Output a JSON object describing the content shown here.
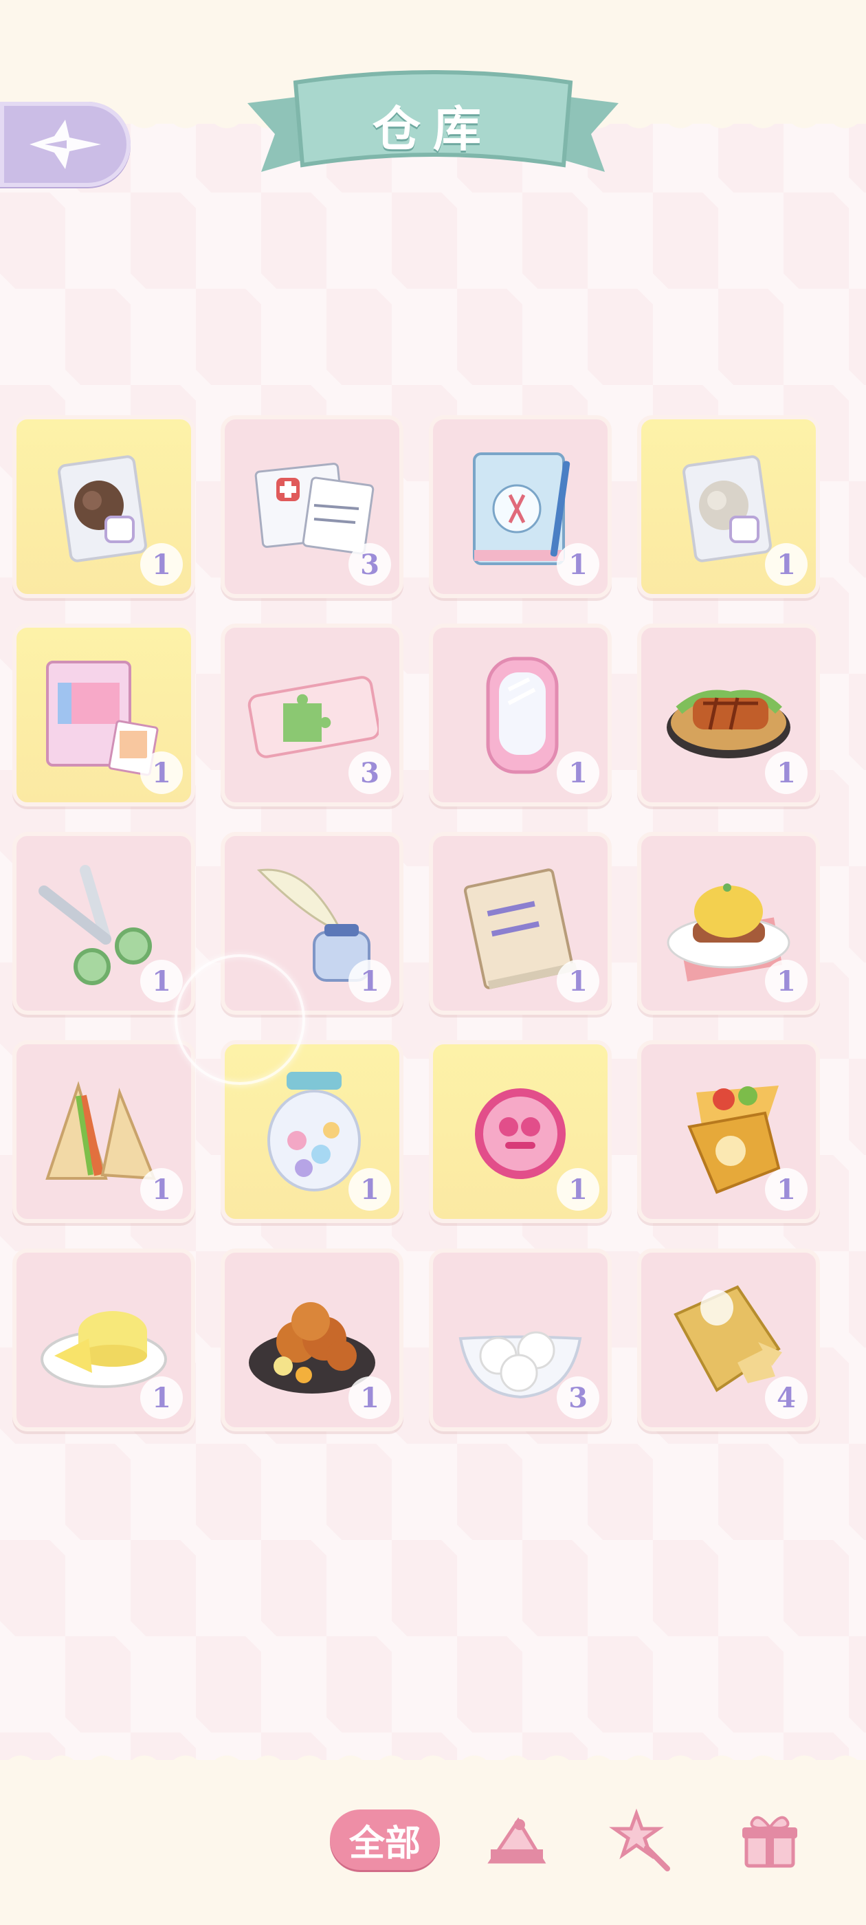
{
  "header": {
    "title": "仓库"
  },
  "back_button": {
    "icon": "winged-arrow-back-icon",
    "color": "#cbbde6"
  },
  "inventory": {
    "items": [
      {
        "icon": "brown-wool-bag-icon",
        "count": "1",
        "rarity": "gold"
      },
      {
        "icon": "medical-papers-icon",
        "count": "3",
        "rarity": "pink"
      },
      {
        "icon": "craft-notebook-icon",
        "count": "1",
        "rarity": "pink"
      },
      {
        "icon": "white-wool-bag-icon",
        "count": "1",
        "rarity": "gold"
      },
      {
        "icon": "sticker-pack-icon",
        "count": "1",
        "rarity": "gold"
      },
      {
        "icon": "puzzle-ticket-icon",
        "count": "3",
        "rarity": "pink"
      },
      {
        "icon": "pink-mirror-icon",
        "count": "1",
        "rarity": "pink"
      },
      {
        "icon": "glazed-cutlet-dish-icon",
        "count": "1",
        "rarity": "pink"
      },
      {
        "icon": "green-scissors-icon",
        "count": "1",
        "rarity": "pink"
      },
      {
        "icon": "quill-and-ink-icon",
        "count": "1",
        "rarity": "pink"
      },
      {
        "icon": "craft-encyclopedia-icon",
        "count": "1",
        "rarity": "pink"
      },
      {
        "icon": "eggs-benedict-icon",
        "count": "1",
        "rarity": "pink"
      },
      {
        "icon": "sandwich-icon",
        "count": "1",
        "rarity": "pink"
      },
      {
        "icon": "candy-bear-jar-icon",
        "count": "1",
        "rarity": "gold"
      },
      {
        "icon": "pink-badge-icon",
        "count": "1",
        "rarity": "gold"
      },
      {
        "icon": "wrap-burrito-icon",
        "count": "1",
        "rarity": "pink"
      },
      {
        "icon": "cheese-plate-icon",
        "count": "1",
        "rarity": "pink"
      },
      {
        "icon": "fried-chicken-dish-icon",
        "count": "1",
        "rarity": "pink"
      },
      {
        "icon": "rice-balls-bowl-icon",
        "count": "3",
        "rarity": "pink"
      },
      {
        "icon": "chips-bag-icon",
        "count": "4",
        "rarity": "pink"
      }
    ]
  },
  "tabs": {
    "all_label": "全部",
    "icons": [
      "cake-slice-icon",
      "magic-wand-icon",
      "gift-box-icon"
    ]
  },
  "colors": {
    "count_text": "#9c8cd8",
    "banner": "#9fd0c6",
    "active_tab": "#ee8ea6"
  }
}
